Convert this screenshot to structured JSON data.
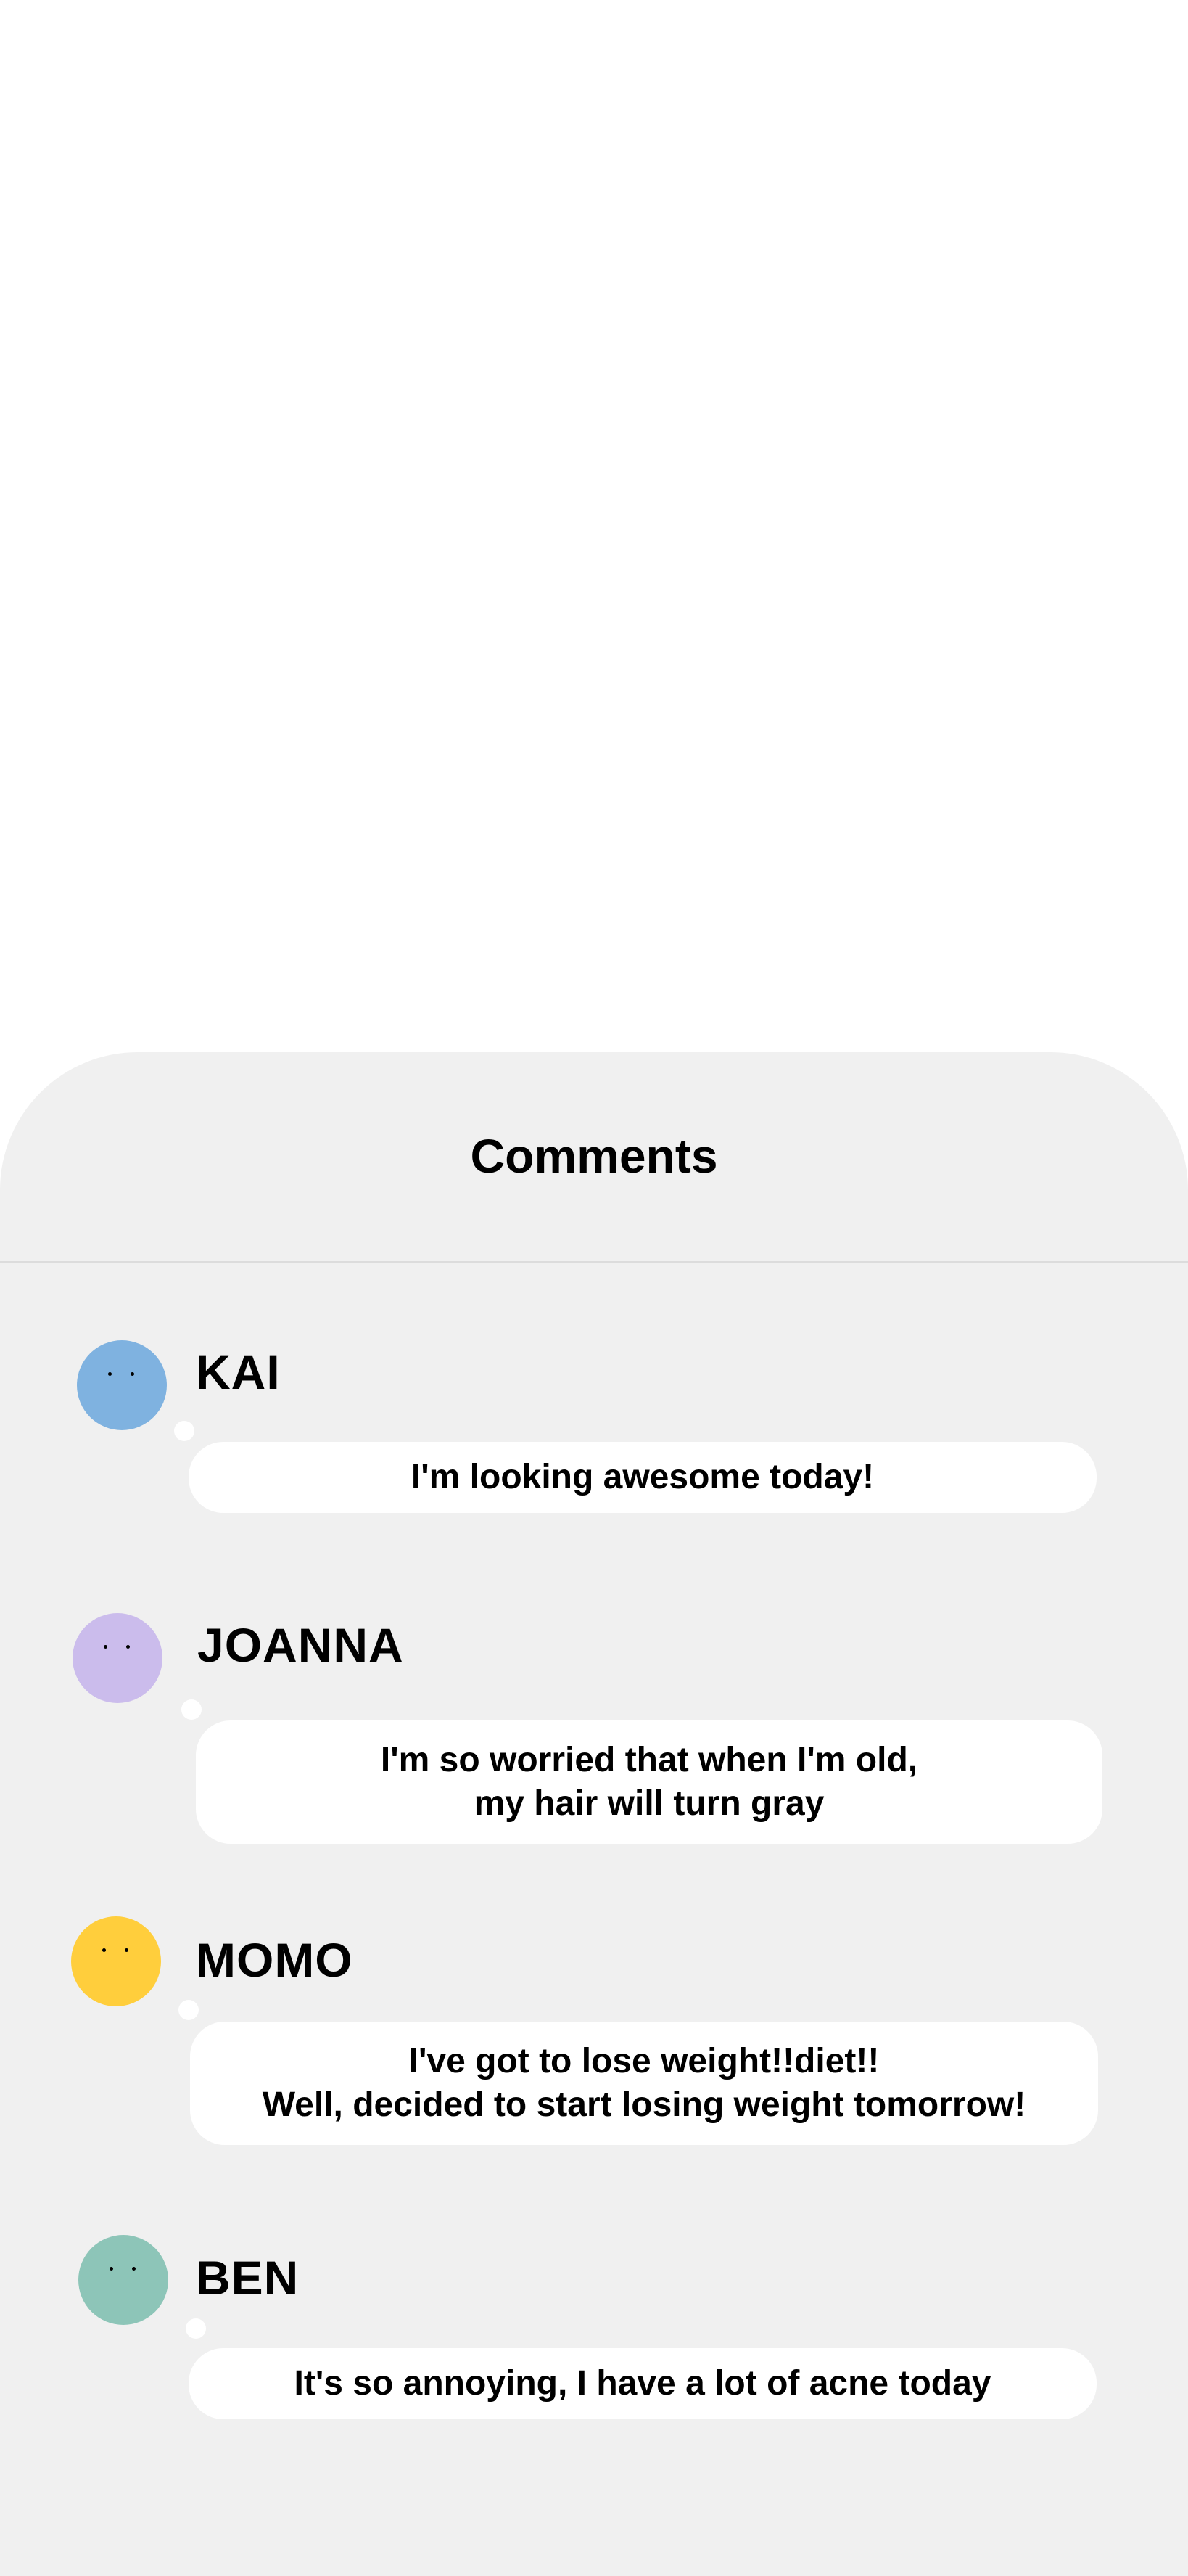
{
  "sheet": {
    "title": "Comments"
  },
  "comments": [
    {
      "name": "KAI",
      "avatar_color": "#7FB2E0",
      "text_lines": [
        "I'm looking awesome today!"
      ]
    },
    {
      "name": "JOANNA",
      "avatar_color": "#CBBCEC",
      "text_lines": [
        "I'm so worried that when I'm old,",
        "my hair will turn gray"
      ]
    },
    {
      "name": "MOMO",
      "avatar_color": "#FFCE3C",
      "text_lines": [
        "I've got to lose weight!!diet!!",
        "Well, decided to start losing weight tomorrow!"
      ]
    },
    {
      "name": "BEN",
      "avatar_color": "#8DC5B8",
      "text_lines": [
        "It's so annoying, I have a lot of acne today"
      ]
    }
  ],
  "colors": {
    "sheet_background": "#F0F0F0",
    "page_background": "#FFFFFF",
    "bubble_background": "#FFFFFF",
    "text": "#000000"
  }
}
